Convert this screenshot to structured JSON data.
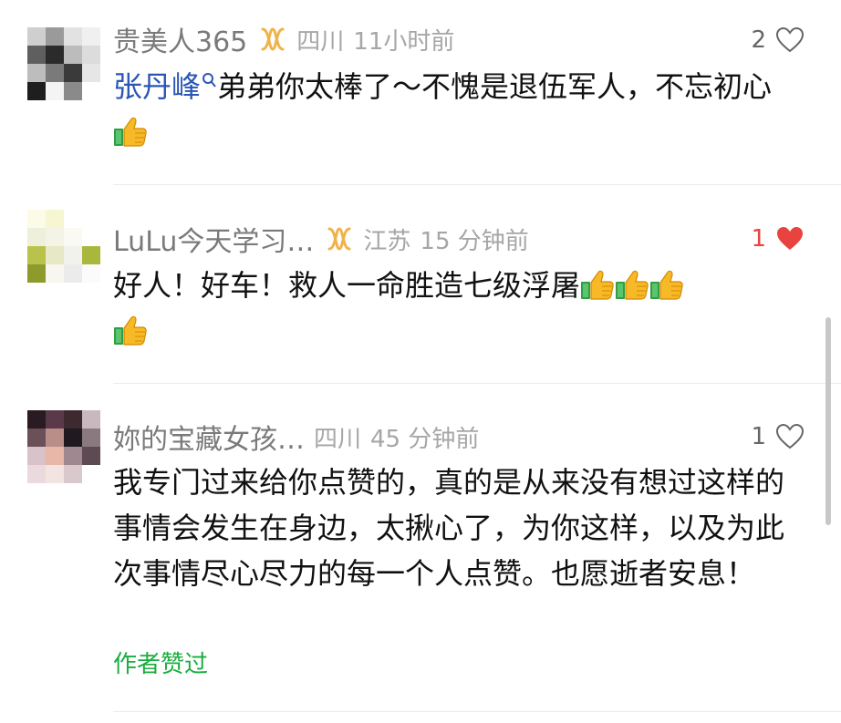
{
  "comments": [
    {
      "username": "贵美人365",
      "location": "四川",
      "time": "11小时前",
      "like_count": "2",
      "liked": false,
      "mention": "张丹峰",
      "text": "弟弟你太棒了～不愧是退伍军人，不忘初心",
      "thumbs": 1
    },
    {
      "username": "LuLu今天学习…",
      "location": "江苏",
      "time": "15 分钟前",
      "like_count": "1",
      "liked": true,
      "text": "好人！好车！救人一命胜造七级浮屠",
      "thumbs": 4
    },
    {
      "username": "妳的宝藏女孩…",
      "location": "四川",
      "time": "45 分钟前",
      "like_count": "1",
      "liked": false,
      "text": "我专门过来给你点赞的，真的是从来没有想过这样的事情会发生在身边，太揪心了，为你这样，以及为此次事情尽心尽力的每一个人点赞。也愿逝者安息！",
      "author_liked": "作者赞过"
    }
  ],
  "colors": {
    "like_active": "#e8433f",
    "mention": "#2a56b6",
    "author_liked": "#1aad3f",
    "badge": "#f0b34a"
  }
}
